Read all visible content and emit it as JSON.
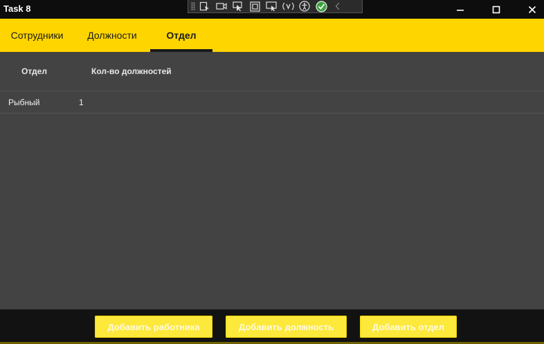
{
  "window": {
    "title": "Task 8",
    "dev_toolbar_icons": [
      "select-element-icon",
      "video-icon",
      "pointer-icon",
      "square-icon",
      "display-layout-icon",
      "hot-reload-icon",
      "accessibility-icon",
      "check-circle-icon",
      "chevron-left-icon"
    ]
  },
  "tabs": [
    {
      "label": "Сотрудники",
      "active": false
    },
    {
      "label": "Должности",
      "active": false
    },
    {
      "label": "Отдел",
      "active": true
    }
  ],
  "table": {
    "columns": [
      "Отдел",
      "Кол-во должностей"
    ],
    "rows": [
      {
        "department": "Рыбный",
        "positions_count": "1"
      }
    ]
  },
  "actions": {
    "add_worker": "Добавить работника",
    "add_position": "Добавить должность",
    "add_department": "Добавить отдел"
  },
  "colors": {
    "accent": "#ffd500",
    "button": "#fde83c",
    "grid_bg": "#434343",
    "chrome_bg": "#0d0d0d"
  }
}
